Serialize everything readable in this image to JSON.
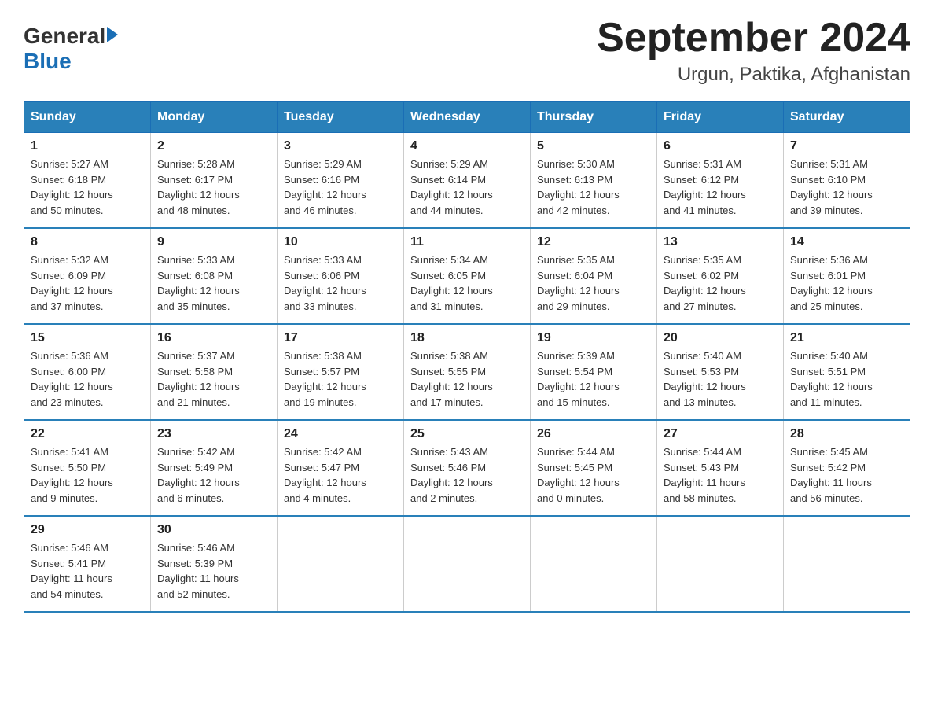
{
  "logo": {
    "general": "General",
    "blue": "Blue"
  },
  "title": {
    "month_year": "September 2024",
    "location": "Urgun, Paktika, Afghanistan"
  },
  "headers": [
    "Sunday",
    "Monday",
    "Tuesday",
    "Wednesday",
    "Thursday",
    "Friday",
    "Saturday"
  ],
  "weeks": [
    [
      {
        "day": "1",
        "sunrise": "5:27 AM",
        "sunset": "6:18 PM",
        "daylight": "12 hours and 50 minutes."
      },
      {
        "day": "2",
        "sunrise": "5:28 AM",
        "sunset": "6:17 PM",
        "daylight": "12 hours and 48 minutes."
      },
      {
        "day": "3",
        "sunrise": "5:29 AM",
        "sunset": "6:16 PM",
        "daylight": "12 hours and 46 minutes."
      },
      {
        "day": "4",
        "sunrise": "5:29 AM",
        "sunset": "6:14 PM",
        "daylight": "12 hours and 44 minutes."
      },
      {
        "day": "5",
        "sunrise": "5:30 AM",
        "sunset": "6:13 PM",
        "daylight": "12 hours and 42 minutes."
      },
      {
        "day": "6",
        "sunrise": "5:31 AM",
        "sunset": "6:12 PM",
        "daylight": "12 hours and 41 minutes."
      },
      {
        "day": "7",
        "sunrise": "5:31 AM",
        "sunset": "6:10 PM",
        "daylight": "12 hours and 39 minutes."
      }
    ],
    [
      {
        "day": "8",
        "sunrise": "5:32 AM",
        "sunset": "6:09 PM",
        "daylight": "12 hours and 37 minutes."
      },
      {
        "day": "9",
        "sunrise": "5:33 AM",
        "sunset": "6:08 PM",
        "daylight": "12 hours and 35 minutes."
      },
      {
        "day": "10",
        "sunrise": "5:33 AM",
        "sunset": "6:06 PM",
        "daylight": "12 hours and 33 minutes."
      },
      {
        "day": "11",
        "sunrise": "5:34 AM",
        "sunset": "6:05 PM",
        "daylight": "12 hours and 31 minutes."
      },
      {
        "day": "12",
        "sunrise": "5:35 AM",
        "sunset": "6:04 PM",
        "daylight": "12 hours and 29 minutes."
      },
      {
        "day": "13",
        "sunrise": "5:35 AM",
        "sunset": "6:02 PM",
        "daylight": "12 hours and 27 minutes."
      },
      {
        "day": "14",
        "sunrise": "5:36 AM",
        "sunset": "6:01 PM",
        "daylight": "12 hours and 25 minutes."
      }
    ],
    [
      {
        "day": "15",
        "sunrise": "5:36 AM",
        "sunset": "6:00 PM",
        "daylight": "12 hours and 23 minutes."
      },
      {
        "day": "16",
        "sunrise": "5:37 AM",
        "sunset": "5:58 PM",
        "daylight": "12 hours and 21 minutes."
      },
      {
        "day": "17",
        "sunrise": "5:38 AM",
        "sunset": "5:57 PM",
        "daylight": "12 hours and 19 minutes."
      },
      {
        "day": "18",
        "sunrise": "5:38 AM",
        "sunset": "5:55 PM",
        "daylight": "12 hours and 17 minutes."
      },
      {
        "day": "19",
        "sunrise": "5:39 AM",
        "sunset": "5:54 PM",
        "daylight": "12 hours and 15 minutes."
      },
      {
        "day": "20",
        "sunrise": "5:40 AM",
        "sunset": "5:53 PM",
        "daylight": "12 hours and 13 minutes."
      },
      {
        "day": "21",
        "sunrise": "5:40 AM",
        "sunset": "5:51 PM",
        "daylight": "12 hours and 11 minutes."
      }
    ],
    [
      {
        "day": "22",
        "sunrise": "5:41 AM",
        "sunset": "5:50 PM",
        "daylight": "12 hours and 9 minutes."
      },
      {
        "day": "23",
        "sunrise": "5:42 AM",
        "sunset": "5:49 PM",
        "daylight": "12 hours and 6 minutes."
      },
      {
        "day": "24",
        "sunrise": "5:42 AM",
        "sunset": "5:47 PM",
        "daylight": "12 hours and 4 minutes."
      },
      {
        "day": "25",
        "sunrise": "5:43 AM",
        "sunset": "5:46 PM",
        "daylight": "12 hours and 2 minutes."
      },
      {
        "day": "26",
        "sunrise": "5:44 AM",
        "sunset": "5:45 PM",
        "daylight": "12 hours and 0 minutes."
      },
      {
        "day": "27",
        "sunrise": "5:44 AM",
        "sunset": "5:43 PM",
        "daylight": "11 hours and 58 minutes."
      },
      {
        "day": "28",
        "sunrise": "5:45 AM",
        "sunset": "5:42 PM",
        "daylight": "11 hours and 56 minutes."
      }
    ],
    [
      {
        "day": "29",
        "sunrise": "5:46 AM",
        "sunset": "5:41 PM",
        "daylight": "11 hours and 54 minutes."
      },
      {
        "day": "30",
        "sunrise": "5:46 AM",
        "sunset": "5:39 PM",
        "daylight": "11 hours and 52 minutes."
      },
      null,
      null,
      null,
      null,
      null
    ]
  ],
  "labels": {
    "sunrise": "Sunrise:",
    "sunset": "Sunset:",
    "daylight": "Daylight:"
  }
}
